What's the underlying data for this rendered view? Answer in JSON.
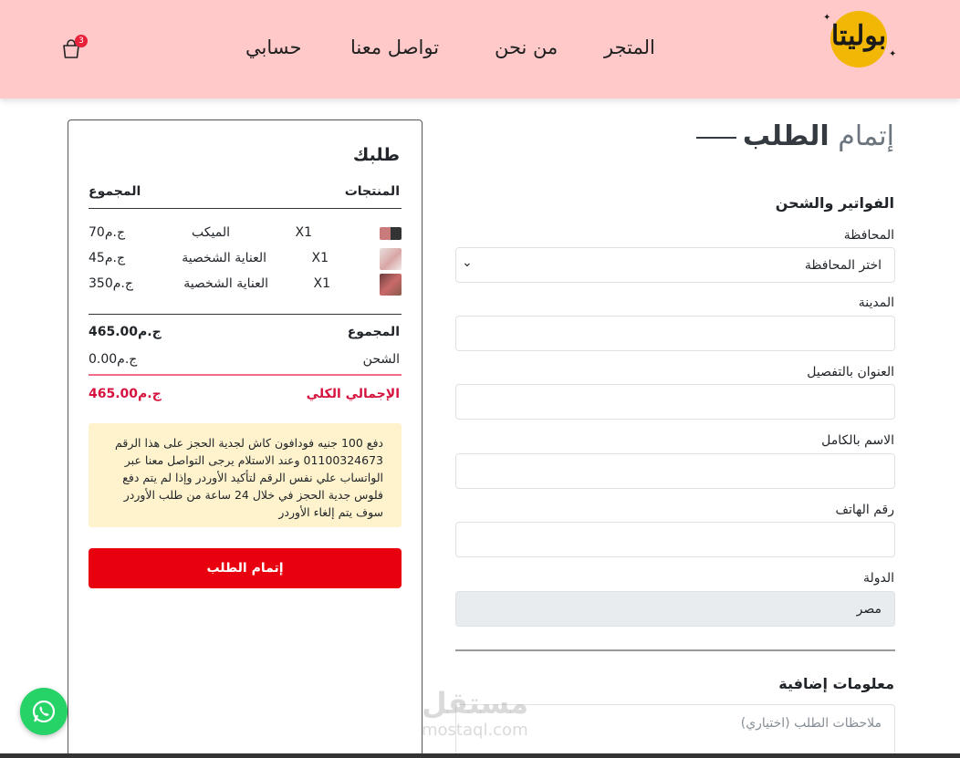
{
  "header": {
    "logo_text": "بوليتا",
    "nav": {
      "store": "المتجر",
      "about": "من نحن",
      "contact": "تواصل معنا",
      "account": "حسابي"
    },
    "cart_count": "3"
  },
  "checkout": {
    "title_light": "إتمام",
    "title_bold": "الطلب",
    "billing_heading": "الفواتير والشحن",
    "fields": {
      "governorate_label": "المحافظة",
      "governorate_value": "اختر المحافظة",
      "city_label": "المدينة",
      "address_label": "العنوان بالتفصيل",
      "fullname_label": "الاسم بالكامل",
      "phone_label": "رقم الهاتف",
      "country_label": "الدولة",
      "country_value": "مصر"
    },
    "extra_heading": "معلومات إضافية",
    "notes_placeholder": "ملاحظات الطلب (اختياري)"
  },
  "order": {
    "title": "طلبك",
    "col_products": "المنتجات",
    "col_total": "المجموع",
    "items": [
      {
        "qty": "X1",
        "name": "الميكب",
        "price": "ج.م70"
      },
      {
        "qty": "X1",
        "name": "العناية الشخصية",
        "price": "ج.م45"
      },
      {
        "qty": "X1",
        "name": "العناية الشخصية",
        "price": "ج.م350"
      }
    ],
    "subtotal_label": "المجموع",
    "subtotal_value": "ج.م465.00",
    "shipping_label": "الشحن",
    "shipping_value": "ج.م0.00",
    "grand_label": "الإجمالي الكلي",
    "grand_value": "ج.م465.00",
    "note": "دفع 100 جنيه فودافون كاش لجدية الحجز على هذا الرقم 01100324673 وعند الاستلام يرجى التواصل معنا عبر الواتساب علي نفس الرقم لتأكيد الأوردر وإذا لم يتم دفع فلوس جدية الحجز في خلال 24 ساعة من طلب الأوردر سوف يتم إلغاء الأوردر",
    "place_order_label": "إتمام الطلب"
  },
  "watermark": {
    "ar": "مستقل",
    "en": "mostaql.com"
  },
  "colors": {
    "header_bg": "#ffc9c9",
    "accent_red": "#e8000e",
    "grand_total": "#d6133f",
    "note_bg": "#fff3cd",
    "whatsapp": "#25d366"
  }
}
